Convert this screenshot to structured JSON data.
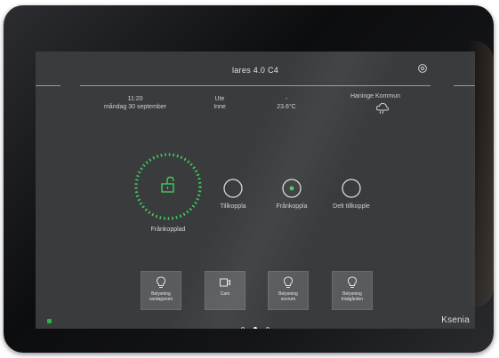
{
  "header": {
    "title": "lares 4.0 C4"
  },
  "info": {
    "time": "11:20",
    "date": "måndag 30 september",
    "sensor1_label": "Ute",
    "sensor1_value": "Inne",
    "sensor2_label": "-",
    "sensor2_value": "23.6°C",
    "location": "Haninge Kommun"
  },
  "alarm": {
    "state": "Frånkopplad"
  },
  "modes": [
    {
      "label": "Tillkoppla"
    },
    {
      "label": "Frånkoppla"
    },
    {
      "label": "Delt tillkopple"
    }
  ],
  "tiles": [
    {
      "label_line1": "Belysning",
      "label_line2": "vardagsrum",
      "icon": "lightbulb-icon"
    },
    {
      "label_line1": "Cam",
      "label_line2": "",
      "icon": "camera-icon"
    },
    {
      "label_line1": "Belysning",
      "label_line2": "sovrum",
      "icon": "lightbulb-icon"
    },
    {
      "label_line1": "Belysning",
      "label_line2": "trädgården",
      "icon": "lightbulb-icon"
    }
  ],
  "pager": {
    "total": 3,
    "current": 2
  },
  "brand": "Ksenia",
  "colors": {
    "accent": "#2bb24c",
    "screen": "#3a3b3d",
    "tile": "#5a5b5d"
  }
}
